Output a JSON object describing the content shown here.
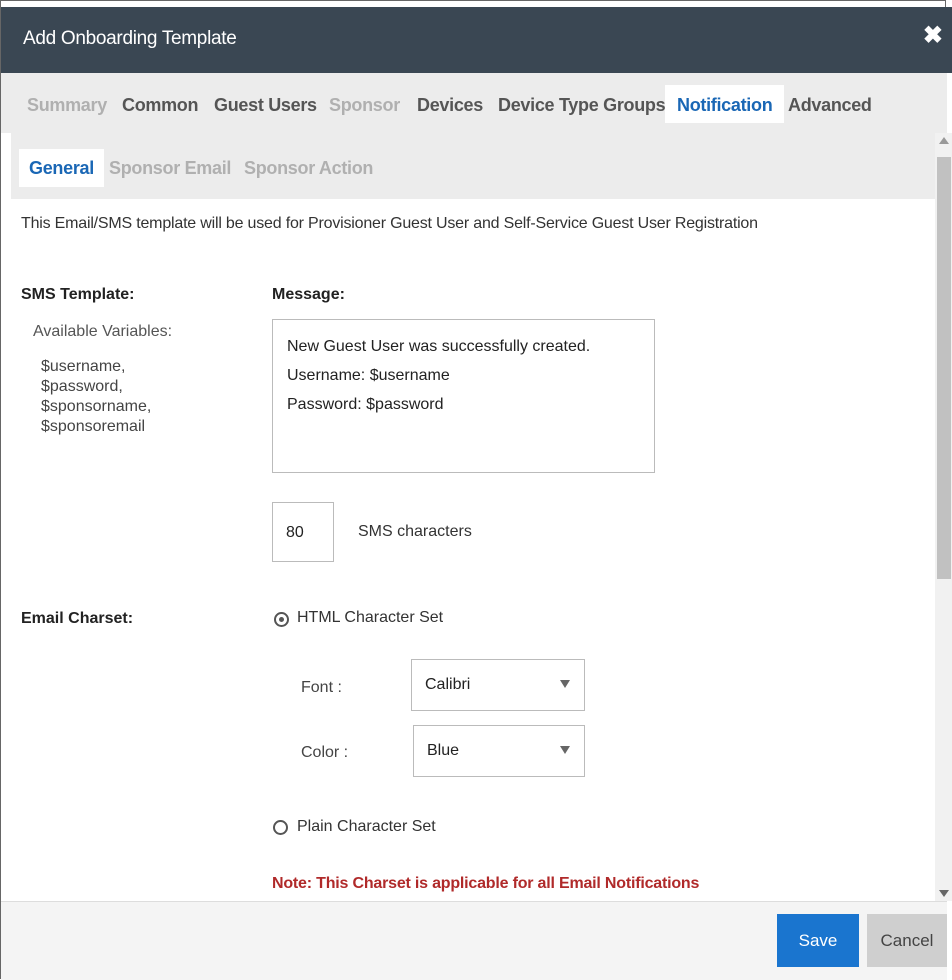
{
  "window": {
    "title": "Add Onboarding Template",
    "close_icon": "close-icon"
  },
  "tabs": [
    {
      "label": "Summary",
      "state": "disabled"
    },
    {
      "label": "Common",
      "state": "normal"
    },
    {
      "label": "Guest Users",
      "state": "normal"
    },
    {
      "label": "Sponsor",
      "state": "disabled"
    },
    {
      "label": "Devices",
      "state": "normal"
    },
    {
      "label": "Device Type Groups",
      "state": "normal"
    },
    {
      "label": "Notification",
      "state": "active"
    },
    {
      "label": "Advanced",
      "state": "normal"
    }
  ],
  "subtabs": [
    {
      "label": "General",
      "state": "active"
    },
    {
      "label": "Sponsor Email",
      "state": "disabled"
    },
    {
      "label": "Sponsor Action",
      "state": "disabled"
    }
  ],
  "description": "This Email/SMS template will be used for Provisioner Guest User and Self-Service Guest User Registration",
  "sms": {
    "label": "SMS Template:",
    "available_label": "Available Variables:",
    "variables": [
      "$username,",
      "$password,",
      "$sponsorname,",
      "$sponsoremail"
    ],
    "message_label": "Message:",
    "message_lines": [
      "New Guest User was successfully created.",
      "Username: $username",
      "Password: $password"
    ],
    "char_count": "80",
    "char_label": "SMS characters"
  },
  "email_charset": {
    "label": "Email Charset:",
    "html_option": "HTML Character Set",
    "html_selected": true,
    "font_label": "Font :",
    "font_value": "Calibri",
    "color_label": "Color :",
    "color_value": "Blue",
    "plain_option": "Plain Character Set",
    "note": "Note: This Charset is applicable for all Email Notifications"
  },
  "footer": {
    "save_label": "Save",
    "cancel_label": "Cancel"
  },
  "colors": {
    "titlebar": "#3a4753",
    "accent": "#1a67b5",
    "save": "#1a75cf",
    "note": "#b02a2a"
  }
}
